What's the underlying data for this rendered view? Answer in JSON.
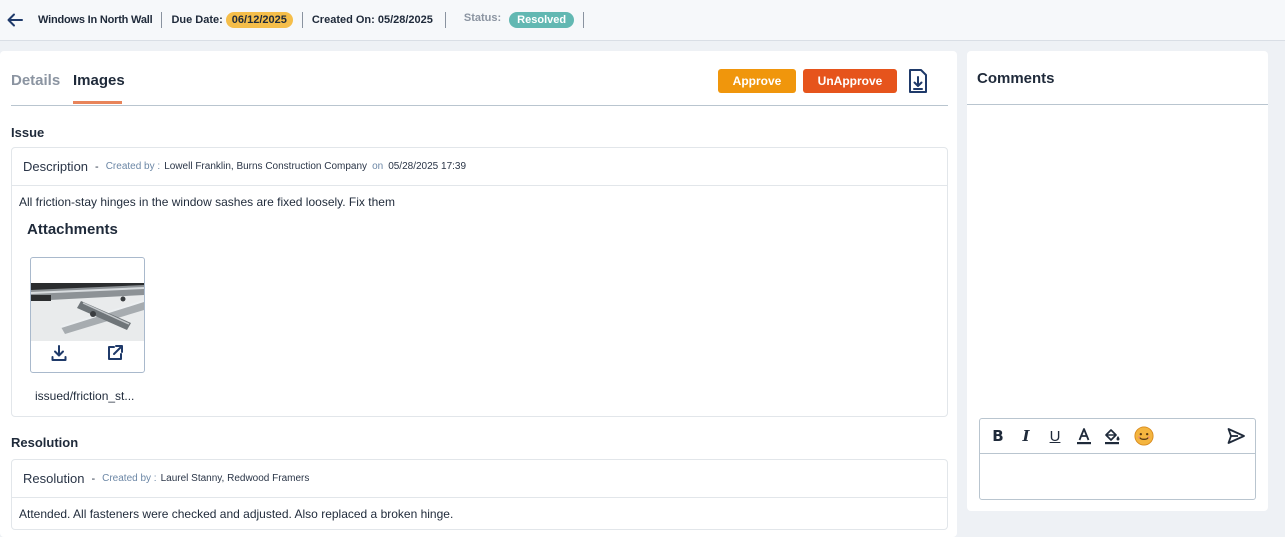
{
  "header": {
    "title": "Windows In North Wall",
    "due_label": "Due Date:",
    "due_value": "06/12/2025",
    "created_label": "Created On:",
    "created_value": "05/28/2025",
    "status_label": "Status:",
    "status_value": "Resolved",
    "colors": {
      "due_badge": "#f5be4a",
      "status_badge": "#62b8b2"
    }
  },
  "tabs": [
    {
      "label": "Details",
      "active": false
    },
    {
      "label": "Images",
      "active": true
    }
  ],
  "actions": {
    "approve_label": "Approve",
    "unapprove_label": "UnApprove",
    "export_icon": "file-download-icon",
    "colors": {
      "approve": "#f0960c",
      "unapprove": "#e6541c"
    }
  },
  "issue": {
    "section_title": "Issue",
    "heading": "Description",
    "dash": "-",
    "created_by_label": "Created by :",
    "created_by": "Lowell Franklin, Burns Construction Company",
    "on_label": "on",
    "created_at": "05/28/2025 17:39",
    "text": "All friction-stay hinges in the window sashes are fixed loosely. Fix them",
    "attachments_title": "Attachments",
    "attachments": [
      {
        "filename": "issued/friction_st...",
        "download_icon": "download-icon",
        "open_icon": "open-external-icon"
      }
    ]
  },
  "resolution": {
    "section_title": "Resolution",
    "heading": "Resolution",
    "dash": "-",
    "created_by_label": "Created by :",
    "created_by": "Laurel Stanny, Redwood Framers",
    "text": "Attended. All fasteners were checked and adjusted. Also replaced a broken hinge."
  },
  "comments": {
    "title": "Comments",
    "toolbar": {
      "bold": "B",
      "italic": "I",
      "underline": "U",
      "font_color": "A",
      "icons": [
        "bold-icon",
        "italic-icon",
        "underline-icon",
        "font-color-icon",
        "fill-color-icon",
        "emoji-icon",
        "send-icon"
      ]
    },
    "input_value": ""
  }
}
